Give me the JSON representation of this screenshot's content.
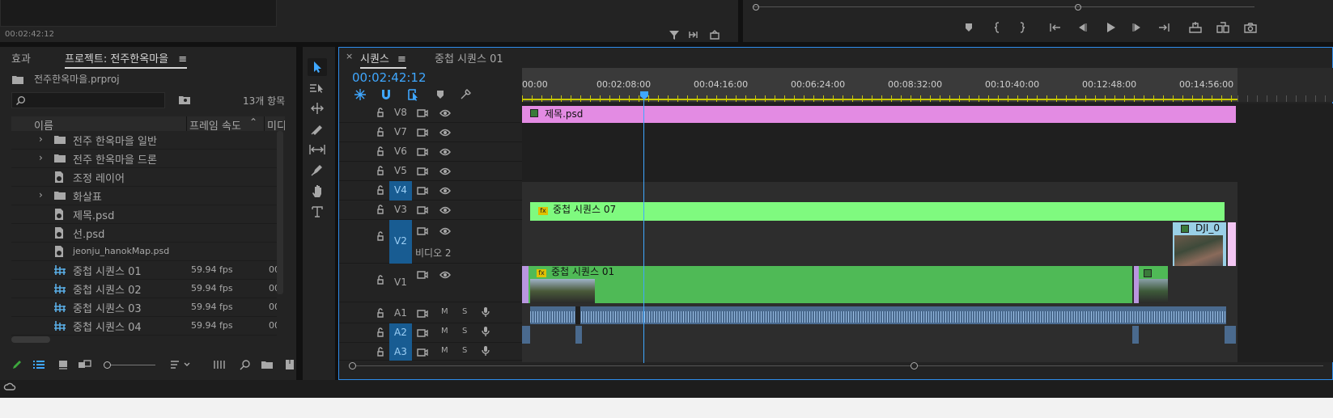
{
  "top": {
    "source_timecode": "00:02:42:12"
  },
  "project": {
    "tab_effects": "효과",
    "tab_project": "프로젝트: 전주한옥마을",
    "file_name": "전주한옥마을.prproj",
    "search_placeholder": "",
    "item_count": "13개 항목",
    "col_name": "이름",
    "col_fps": "프레임 속도",
    "col_media": "미디",
    "items": [
      {
        "label": "전주 한옥마을 일반",
        "type": "folder",
        "fps": "",
        "extra": ""
      },
      {
        "label": "전주 한옥마을 드론",
        "type": "folder",
        "fps": "",
        "extra": ""
      },
      {
        "label": "조정 레이어",
        "type": "file",
        "fps": "",
        "extra": ""
      },
      {
        "label": "화살표",
        "type": "folder",
        "fps": "",
        "extra": ""
      },
      {
        "label": "제목.psd",
        "type": "file",
        "fps": "",
        "extra": ""
      },
      {
        "label": "선.psd",
        "type": "file",
        "fps": "",
        "extra": ""
      },
      {
        "label": "jeonju_hanokMap.psd",
        "type": "file",
        "fps": "",
        "extra": ""
      },
      {
        "label": "중첩 시퀀스 01",
        "type": "sequence",
        "fps": "59.94 fps",
        "extra": "00"
      },
      {
        "label": "중첩 시퀀스 02",
        "type": "sequence",
        "fps": "59.94 fps",
        "extra": "00"
      },
      {
        "label": "중첩 시퀀스 03",
        "type": "sequence",
        "fps": "59.94 fps",
        "extra": "00"
      },
      {
        "label": "중첩 시퀀스 04",
        "type": "sequence",
        "fps": "59.94 fps",
        "extra": "00"
      }
    ]
  },
  "timeline": {
    "tab_sequence": "시퀀스",
    "tab_nested": "중첩 시퀀스 01",
    "timecode": "00:02:42:12",
    "ruler": [
      "00:00",
      "00:02:08:00",
      "00:04:16:00",
      "00:06:24:00",
      "00:08:32:00",
      "00:10:40:00",
      "00:12:48:00",
      "00:14:56:00"
    ],
    "video_tracks": [
      "V8",
      "V7",
      "V6",
      "V5",
      "V4",
      "V3",
      "V2",
      "V1"
    ],
    "v2_name": "비디오 2",
    "audio_tracks": [
      "A1",
      "A2",
      "A3"
    ],
    "audio_m": "M",
    "audio_s": "S",
    "clips": {
      "title": "제목.psd",
      "nested07": "중첩 시퀀스 07",
      "nested01": "중첩 시퀀스 01",
      "dji": "DJI_0",
      "fx": "fx"
    }
  },
  "colors": {
    "accent": "#2d8ceb",
    "pink_clip": "#e38be3",
    "light_green_clip": "#7ffa7f",
    "green_clip": "#4fba56",
    "active_track": "#185c92",
    "timecode": "#3fa7ff"
  }
}
